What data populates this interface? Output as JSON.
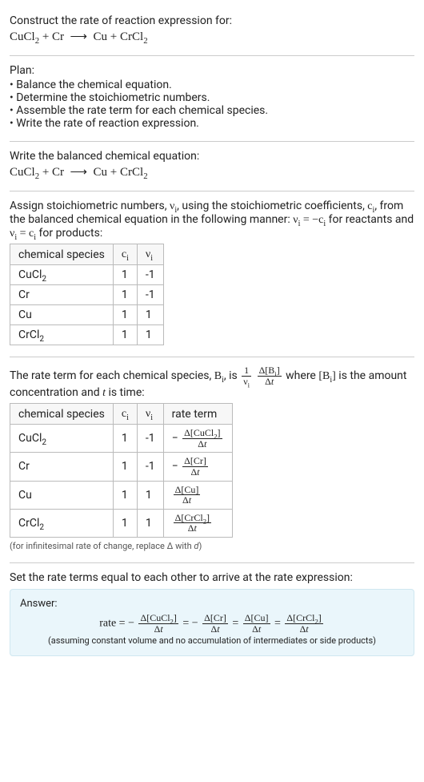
{
  "header": {
    "prompt": "Construct the rate of reaction expression for:"
  },
  "plan": {
    "title": "Plan:",
    "items": [
      "Balance the chemical equation.",
      "Determine the stoichiometric numbers.",
      "Assemble the rate term for each chemical species.",
      "Write the rate of reaction expression."
    ]
  },
  "balanced": {
    "title": "Write the balanced chemical equation:"
  },
  "stoich": {
    "headers": [
      "chemical species",
      "cᵢ",
      "νᵢ"
    ],
    "rows": [
      {
        "species": "CuCl₂",
        "c": "1",
        "v": "-1"
      },
      {
        "species": "Cr",
        "c": "1",
        "v": "-1"
      },
      {
        "species": "Cu",
        "c": "1",
        "v": "1"
      },
      {
        "species": "CrCl₂",
        "c": "1",
        "v": "1"
      }
    ]
  },
  "rateterm": {
    "headers": [
      "chemical species",
      "cᵢ",
      "νᵢ",
      "rate term"
    ],
    "rows": [
      {
        "species": "CuCl₂",
        "c": "1",
        "v": "-1",
        "sign": "− ",
        "num": "Δ[CuCl₂]",
        "den": "Δt"
      },
      {
        "species": "Cr",
        "c": "1",
        "v": "-1",
        "sign": "− ",
        "num": "Δ[Cr]",
        "den": "Δt"
      },
      {
        "species": "Cu",
        "c": "1",
        "v": "1",
        "sign": "",
        "num": "Δ[Cu]",
        "den": "Δt"
      },
      {
        "species": "CrCl₂",
        "c": "1",
        "v": "1",
        "sign": "",
        "num": "Δ[CrCl₂]",
        "den": "Δt"
      }
    ],
    "note_html": "(for infinitesimal rate of change, replace Δ with d)"
  },
  "final": {
    "title": "Set the rate terms equal to each other to arrive at the rate expression:"
  },
  "answer": {
    "label": "Answer:",
    "note": "(assuming constant volume and no accumulation of intermediates or side products)"
  },
  "chart_data": {
    "type": "table",
    "title": "Stoichiometric numbers and rate terms for CuCl2 + Cr → Cu + CrCl2",
    "tables": [
      {
        "name": "stoichiometric_numbers",
        "columns": [
          "chemical species",
          "c_i",
          "nu_i"
        ],
        "rows": [
          [
            "CuCl2",
            1,
            -1
          ],
          [
            "Cr",
            1,
            -1
          ],
          [
            "Cu",
            1,
            1
          ],
          [
            "CrCl2",
            1,
            1
          ]
        ]
      },
      {
        "name": "rate_terms",
        "columns": [
          "chemical species",
          "c_i",
          "nu_i",
          "rate term"
        ],
        "rows": [
          [
            "CuCl2",
            1,
            -1,
            "-Δ[CuCl2]/Δt"
          ],
          [
            "Cr",
            1,
            -1,
            "-Δ[Cr]/Δt"
          ],
          [
            "Cu",
            1,
            1,
            "Δ[Cu]/Δt"
          ],
          [
            "CrCl2",
            1,
            1,
            "Δ[CrCl2]/Δt"
          ]
        ]
      }
    ],
    "annotations": [
      "rate = -Δ[CuCl2]/Δt = -Δ[Cr]/Δt = Δ[Cu]/Δt = Δ[CrCl2]/Δt"
    ]
  }
}
